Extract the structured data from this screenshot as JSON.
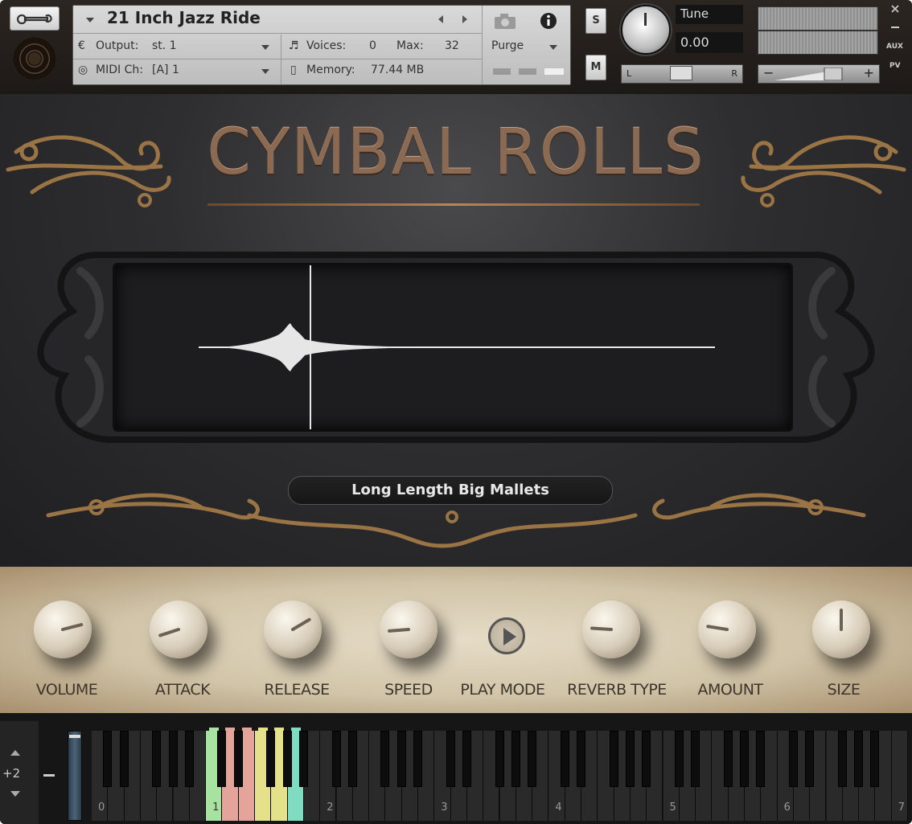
{
  "header": {
    "instrument_name": "21 Inch Jazz Ride",
    "output_label": "Output:",
    "output_value": "st. 1",
    "midi_label": "MIDI Ch:",
    "midi_value": "[A]  1",
    "voices_label": "Voices:",
    "voices_value": "0",
    "max_label": "Max:",
    "max_value": "32",
    "memory_label": "Memory:",
    "memory_value": "77.44 MB",
    "purge_label": "Purge",
    "solo_label": "S",
    "mute_label": "M",
    "tune_label": "Tune",
    "tune_value": "0.00",
    "pan_left": "L",
    "pan_right": "R",
    "vol_minus": "−",
    "vol_plus": "+",
    "aux_label": "AUX",
    "pv_label": "PV"
  },
  "display": {
    "title": "CYMBAL ROLLS",
    "preset_name": "Long Length Big Mallets"
  },
  "controls": {
    "knobs": [
      {
        "label": "VOLUME",
        "value": 0.78
      },
      {
        "label": "ATTACK",
        "value": 0.1
      },
      {
        "label": "RELEASE",
        "value": 0.72
      },
      {
        "label": "SPEED",
        "value": 0.15
      },
      {
        "label": "REVERB TYPE",
        "value": 0.18
      },
      {
        "label": "AMOUNT",
        "value": 0.2
      },
      {
        "label": "SIZE",
        "value": 0.5
      }
    ],
    "play_mode_label": "PLAY MODE"
  },
  "keyboard": {
    "octave_shift": "+2",
    "octave_labels": [
      "0",
      "1",
      "2",
      "3",
      "4",
      "5",
      "6",
      "7"
    ]
  },
  "colors": {
    "title_bronze": "#8a6a52",
    "key_green": "#a8e2a0",
    "key_red": "#e5a49a",
    "key_yellow": "#e5e08a",
    "key_teal": "#7fdcc0"
  }
}
